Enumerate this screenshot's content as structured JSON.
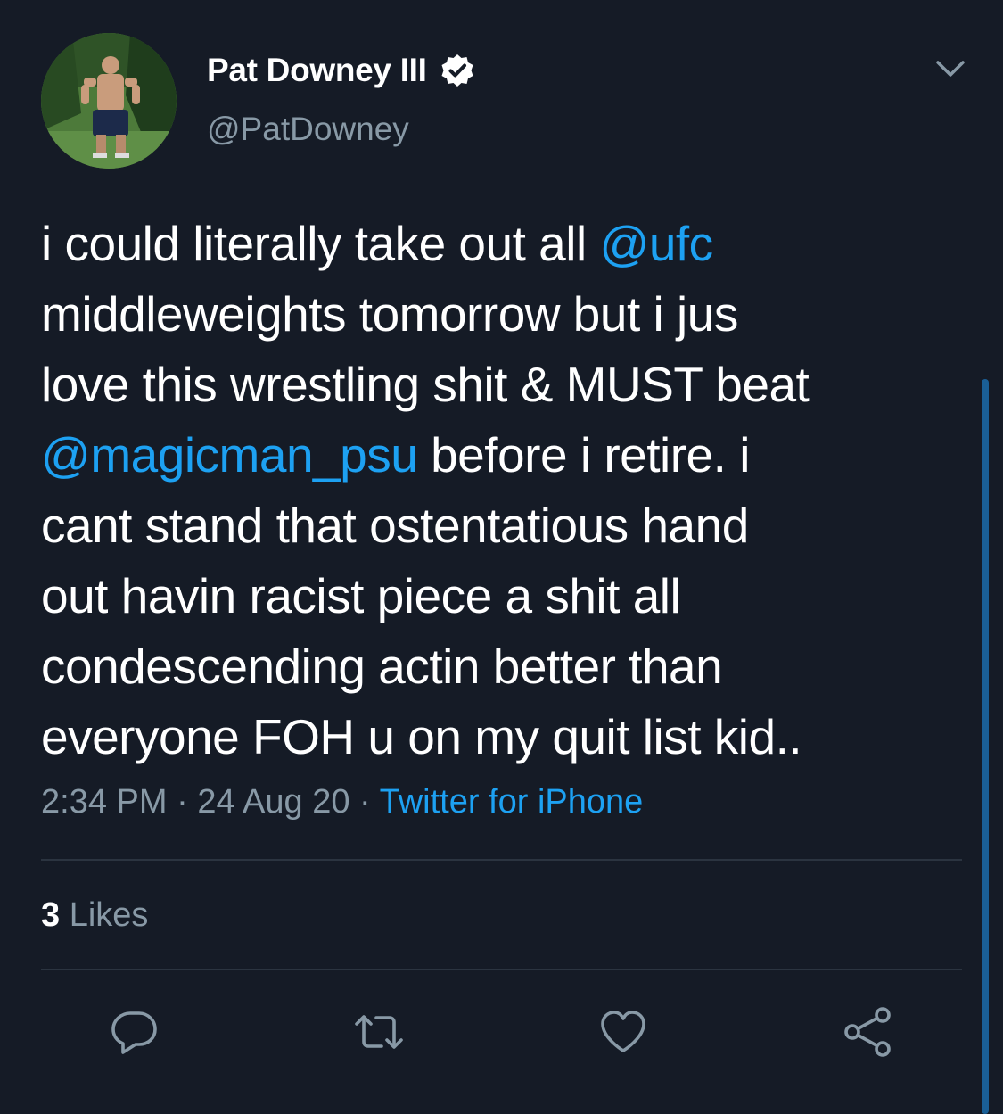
{
  "tweet": {
    "display_name": "Pat Downey III",
    "handle": "@PatDowney",
    "lines": [
      [
        {
          "t": "i could literally take out all ",
          "m": false
        },
        {
          "t": "@ufc",
          "m": true
        }
      ],
      [
        {
          "t": "middleweights tomorrow but i jus",
          "m": false
        }
      ],
      [
        {
          "t": "love this wrestling shit & MUST beat",
          "m": false
        }
      ],
      [
        {
          "t": "@magicman_psu",
          "m": true
        },
        {
          "t": " before i retire. i",
          "m": false
        }
      ],
      [
        {
          "t": "cant stand that ostentatious hand",
          "m": false
        }
      ],
      [
        {
          "t": "out havin racist piece a shit all",
          "m": false
        }
      ],
      [
        {
          "t": "condescending actin better than",
          "m": false
        }
      ],
      [
        {
          "t": "everyone FOH u on my quit list kid..",
          "m": false
        }
      ]
    ],
    "time": "2:34 PM",
    "date": "24 Aug 20",
    "separator": " · ",
    "source": "Twitter for iPhone",
    "likes_count": "3",
    "likes_label": " Likes"
  },
  "icons": {
    "verified": "verified-badge-icon",
    "menu": "chevron-down-icon",
    "reply": "reply-icon",
    "retweet": "retweet-icon",
    "like": "heart-icon",
    "share": "share-icon"
  },
  "colors": {
    "background": "#151b26",
    "link": "#1da1f2",
    "secondary_text": "#8899a6",
    "divider": "#2b3440"
  }
}
